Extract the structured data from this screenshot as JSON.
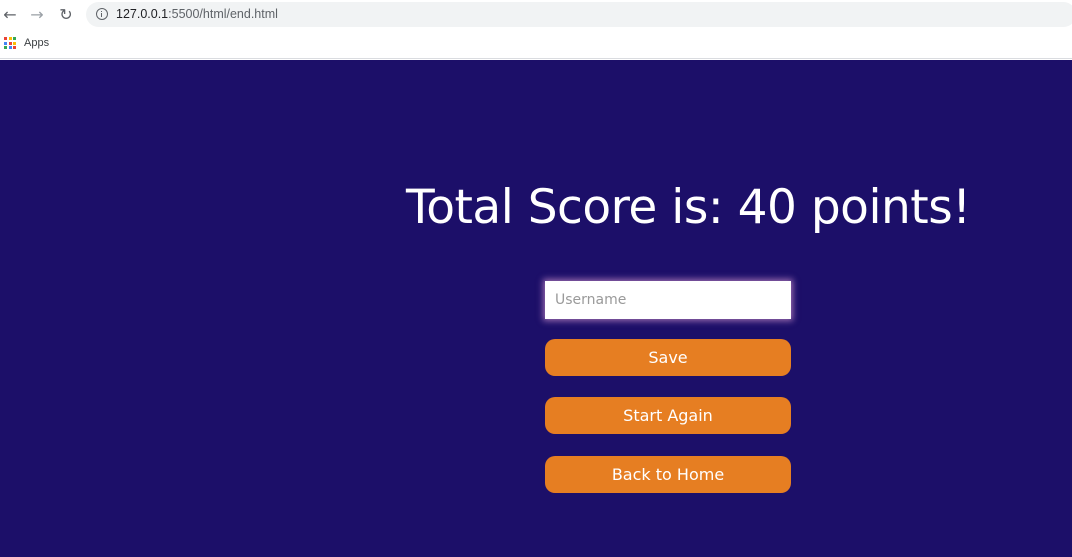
{
  "browser": {
    "back_icon": "arrow-left-icon",
    "forward_icon": "arrow-right-icon",
    "reload_icon": "reload-icon",
    "info_icon": "info-icon",
    "url_host": "127.0.0.1",
    "url_path": ":5500/html/end.html"
  },
  "bookmarks": {
    "apps_label": "Apps"
  },
  "end_page": {
    "title": "Total Score is: 40 points!",
    "username_placeholder": "Username",
    "save_label": "Save",
    "start_again_label": "Start Again",
    "back_home_label": "Back to Home"
  },
  "colors": {
    "background": "#1c0f69",
    "button": "#e67e22",
    "text": "#ffffff"
  }
}
